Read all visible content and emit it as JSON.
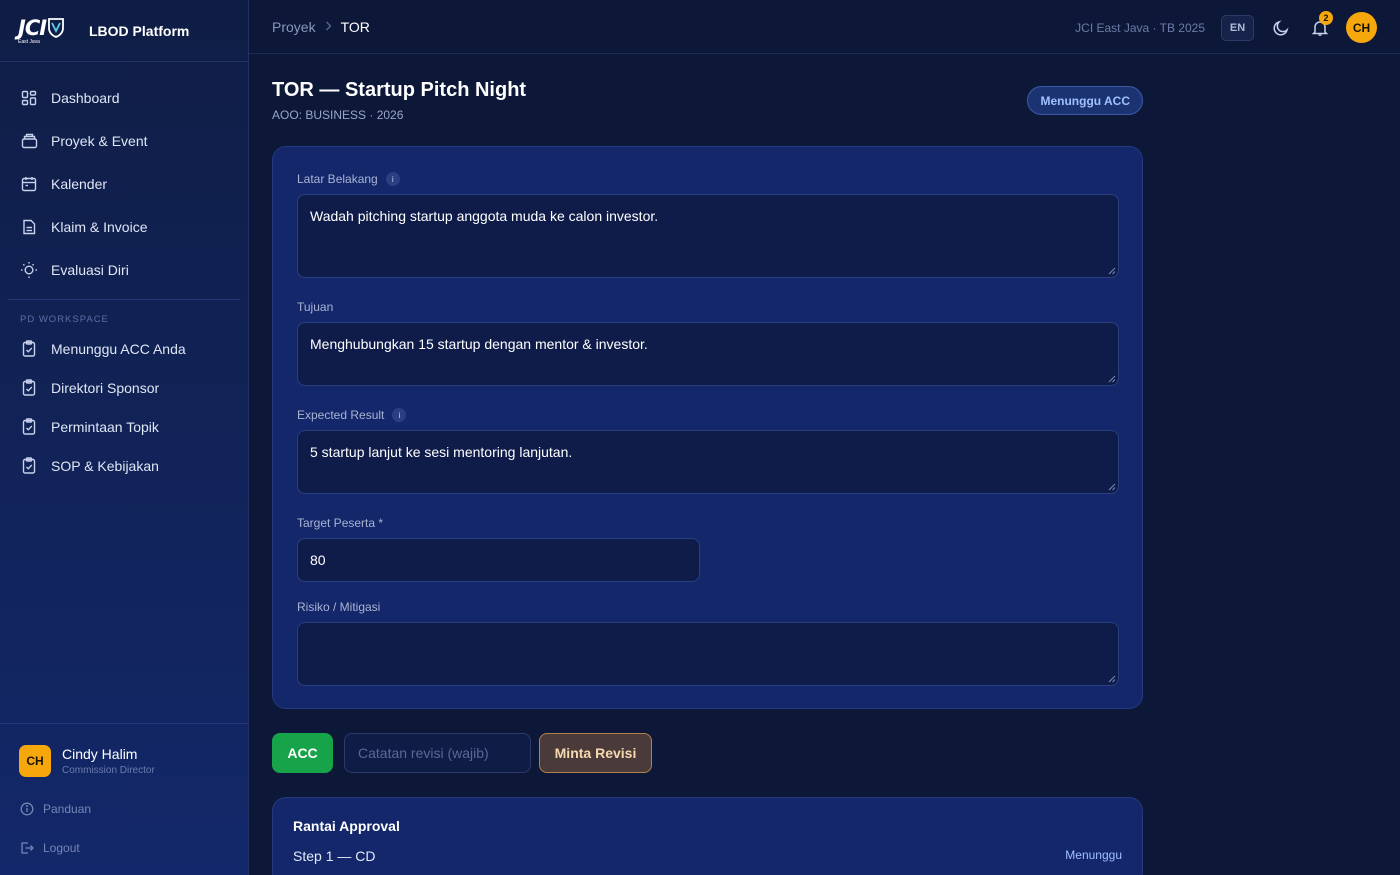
{
  "brand": {
    "logo_text": "JCI",
    "logo_sub": "East Java",
    "app_name": "LBOD Platform"
  },
  "sidebar": {
    "items": [
      {
        "label": "Dashboard",
        "icon": "dashboard-icon"
      },
      {
        "label": "Proyek & Event",
        "icon": "folder-icon"
      },
      {
        "label": "Kalender",
        "icon": "calendar-icon"
      },
      {
        "label": "Klaim & Invoice",
        "icon": "document-icon"
      },
      {
        "label": "Evaluasi Diri",
        "icon": "lightbulb-icon"
      }
    ],
    "section_label": "PD WORKSPACE",
    "workspace_items": [
      {
        "label": "Menunggu ACC Anda",
        "icon": "clipboard-check-icon"
      },
      {
        "label": "Direktori Sponsor",
        "icon": "clipboard-check-icon"
      },
      {
        "label": "Permintaan Topik",
        "icon": "clipboard-check-icon"
      },
      {
        "label": "SOP & Kebijakan",
        "icon": "clipboard-check-icon"
      }
    ],
    "user": {
      "initials": "CH",
      "name": "Cindy Halim",
      "role": "Commission Director"
    },
    "help_label": "Panduan",
    "logout_label": "Logout"
  },
  "topbar": {
    "breadcrumb": [
      "Proyek",
      "TOR"
    ],
    "org": "JCI East Java · TB 2025",
    "lang": "EN",
    "notification_count": "2",
    "avatar_initials": "CH"
  },
  "page": {
    "title": "TOR — Startup Pitch Night",
    "subtitle": "AOO: BUSINESS · 2026",
    "status": "Menunggu ACC"
  },
  "form": {
    "latar_belakang": {
      "label": "Latar Belakang",
      "value": "Wadah pitching startup anggota muda ke calon investor."
    },
    "tujuan": {
      "label": "Tujuan",
      "value": "Menghubungkan 15 startup dengan mentor & investor."
    },
    "expected_result": {
      "label": "Expected Result",
      "value": "5 startup lanjut ke sesi mentoring lanjutan."
    },
    "target_peserta": {
      "label": "Target Peserta *",
      "value": "80"
    },
    "risiko": {
      "label": "Risiko / Mitigasi",
      "value": ""
    }
  },
  "actions": {
    "acc_label": "ACC",
    "note_placeholder": "Catatan revisi (wajib)",
    "revise_label": "Minta Revisi"
  },
  "approval": {
    "title": "Rantai Approval",
    "steps": [
      {
        "name": "Step 1 — CD",
        "status": "Menunggu"
      }
    ]
  },
  "colors": {
    "background": "#0d1838",
    "card": "#13276a",
    "accent": "#f5a70b",
    "success": "#17a34a",
    "status_blue": "#9fc0ff"
  }
}
